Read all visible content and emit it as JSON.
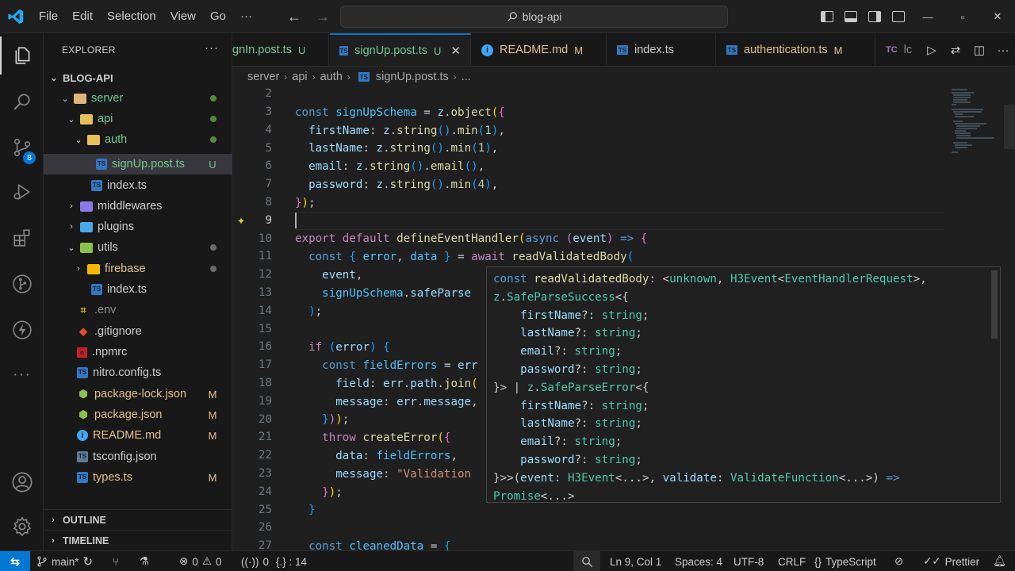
{
  "titlebar": {
    "menu": [
      "File",
      "Edit",
      "Selection",
      "View",
      "Go",
      "···"
    ],
    "search_text": "blog-api"
  },
  "explorer": {
    "title": "EXPLORER",
    "more": "···",
    "project": "BLOG-API",
    "items": [
      {
        "label": "server",
        "status": ""
      },
      {
        "label": "api",
        "status": ""
      },
      {
        "label": "auth",
        "status": ""
      },
      {
        "label": "signUp.post.ts",
        "status": "U"
      },
      {
        "label": "index.ts",
        "status": ""
      },
      {
        "label": "middlewares",
        "status": ""
      },
      {
        "label": "plugins",
        "status": ""
      },
      {
        "label": "utils",
        "status": ""
      },
      {
        "label": "firebase",
        "status": ""
      },
      {
        "label": "index.ts",
        "status": ""
      },
      {
        "label": ".env",
        "status": ""
      },
      {
        "label": ".gitignore",
        "status": ""
      },
      {
        "label": ".npmrc",
        "status": ""
      },
      {
        "label": "nitro.config.ts",
        "status": ""
      },
      {
        "label": "package-lock.json",
        "status": "M"
      },
      {
        "label": "package.json",
        "status": "M"
      },
      {
        "label": "README.md",
        "status": "M"
      },
      {
        "label": "tsconfig.json",
        "status": ""
      },
      {
        "label": "types.ts",
        "status": "M"
      }
    ],
    "outline": "OUTLINE",
    "timeline": "TIMELINE"
  },
  "activity": {
    "scm_badge": "8"
  },
  "tabs": [
    {
      "label": "gnIn.post.ts",
      "status": "U"
    },
    {
      "label": "signUp.post.ts",
      "status": "U"
    },
    {
      "label": "README.md",
      "status": "M"
    },
    {
      "label": "index.ts",
      "status": ""
    },
    {
      "label": "authentication.ts",
      "status": "M"
    },
    {
      "label": "lc",
      "status": ""
    }
  ],
  "breadcrumb": [
    "server",
    "api",
    "auth",
    "signUp.post.ts",
    "..."
  ],
  "editor": {
    "line_numbers": [
      "2",
      "3",
      "4",
      "5",
      "6",
      "7",
      "8",
      "9",
      "10",
      "11",
      "12",
      "13",
      "14",
      "15",
      "16",
      "17",
      "18",
      "19",
      "20",
      "21",
      "22",
      "23",
      "24",
      "25",
      "26",
      "27"
    ],
    "current_line": "9"
  },
  "statusbar": {
    "branch": "main*",
    "errors": "0",
    "warnings": "0",
    "ports": "0",
    "json_ref": "{.} : 14",
    "position": "Ln 9, Col 1",
    "spaces": "Spaces: 4",
    "encoding": "UTF-8",
    "eol": "CRLF",
    "language": "TypeScript",
    "prettier": "Prettier"
  }
}
